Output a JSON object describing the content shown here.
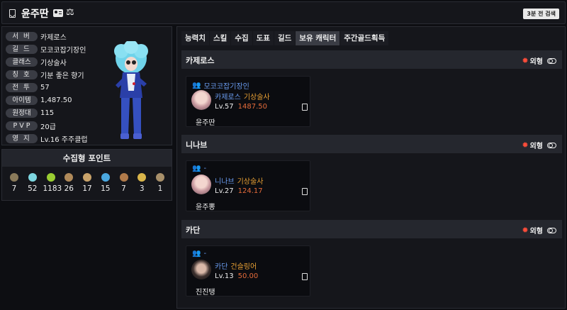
{
  "header": {
    "name": "윤주딴",
    "refresh_label": "3분 전 검색"
  },
  "profile": {
    "rows": [
      {
        "label": "서 버",
        "value": "카제로스"
      },
      {
        "label": "길 드",
        "value": "모코코잡기장인"
      },
      {
        "label": "클래스",
        "value": "기상술사"
      },
      {
        "label": "칭 호",
        "value": "기분 좋은 향기"
      },
      {
        "label": "전 투",
        "value": "57"
      },
      {
        "label": "아이템",
        "value": "1,487.50"
      },
      {
        "label": "원정대",
        "value": "115"
      },
      {
        "label": "P V P",
        "value": "20급"
      },
      {
        "label": "영 지",
        "value": "Lv.16 주주클럽"
      }
    ]
  },
  "collect": {
    "title": "수집형 포인트",
    "items": [
      {
        "icon": "mokoko-seed-icon",
        "color": "#8a7a5a",
        "value": "7"
      },
      {
        "icon": "island-heart-icon",
        "color": "#7dd6e0",
        "value": "52"
      },
      {
        "icon": "sprout-icon",
        "color": "#9acd32",
        "value": "1183"
      },
      {
        "icon": "map-icon",
        "color": "#b08a5a",
        "value": "26"
      },
      {
        "icon": "flute-icon",
        "color": "#c9a36a",
        "value": "17"
      },
      {
        "icon": "leaf-icon",
        "color": "#4aa8e0",
        "value": "15"
      },
      {
        "icon": "mask-icon",
        "color": "#b07a4a",
        "value": "7"
      },
      {
        "icon": "star-icon",
        "color": "#d9b54a",
        "value": "3"
      },
      {
        "icon": "coin-icon",
        "color": "#a8906a",
        "value": "1"
      }
    ]
  },
  "tabs": [
    "능력치",
    "스킬",
    "수집",
    "도표",
    "길드",
    "보유 캐릭터",
    "주간골드획득"
  ],
  "active_tab": 5,
  "appearance_label": "외형",
  "servers": [
    {
      "name": "카제로스",
      "characters": [
        {
          "guild": "모코코잡기장인",
          "server": "카제로스",
          "class": "기상술사",
          "level": "Lv.57",
          "item_level": "1487.50",
          "name": "윤주딴"
        }
      ]
    },
    {
      "name": "니나브",
      "characters": [
        {
          "guild": "-",
          "server": "니나브",
          "class": "기상술사",
          "level": "Lv.27",
          "item_level": "124.17",
          "name": "윤주뽕"
        }
      ]
    },
    {
      "name": "카단",
      "characters": [
        {
          "guild": "-",
          "server": "카단",
          "class": "건슬링어",
          "level": "Lv.13",
          "item_level": "50.00",
          "name": "진진탱"
        }
      ]
    }
  ]
}
